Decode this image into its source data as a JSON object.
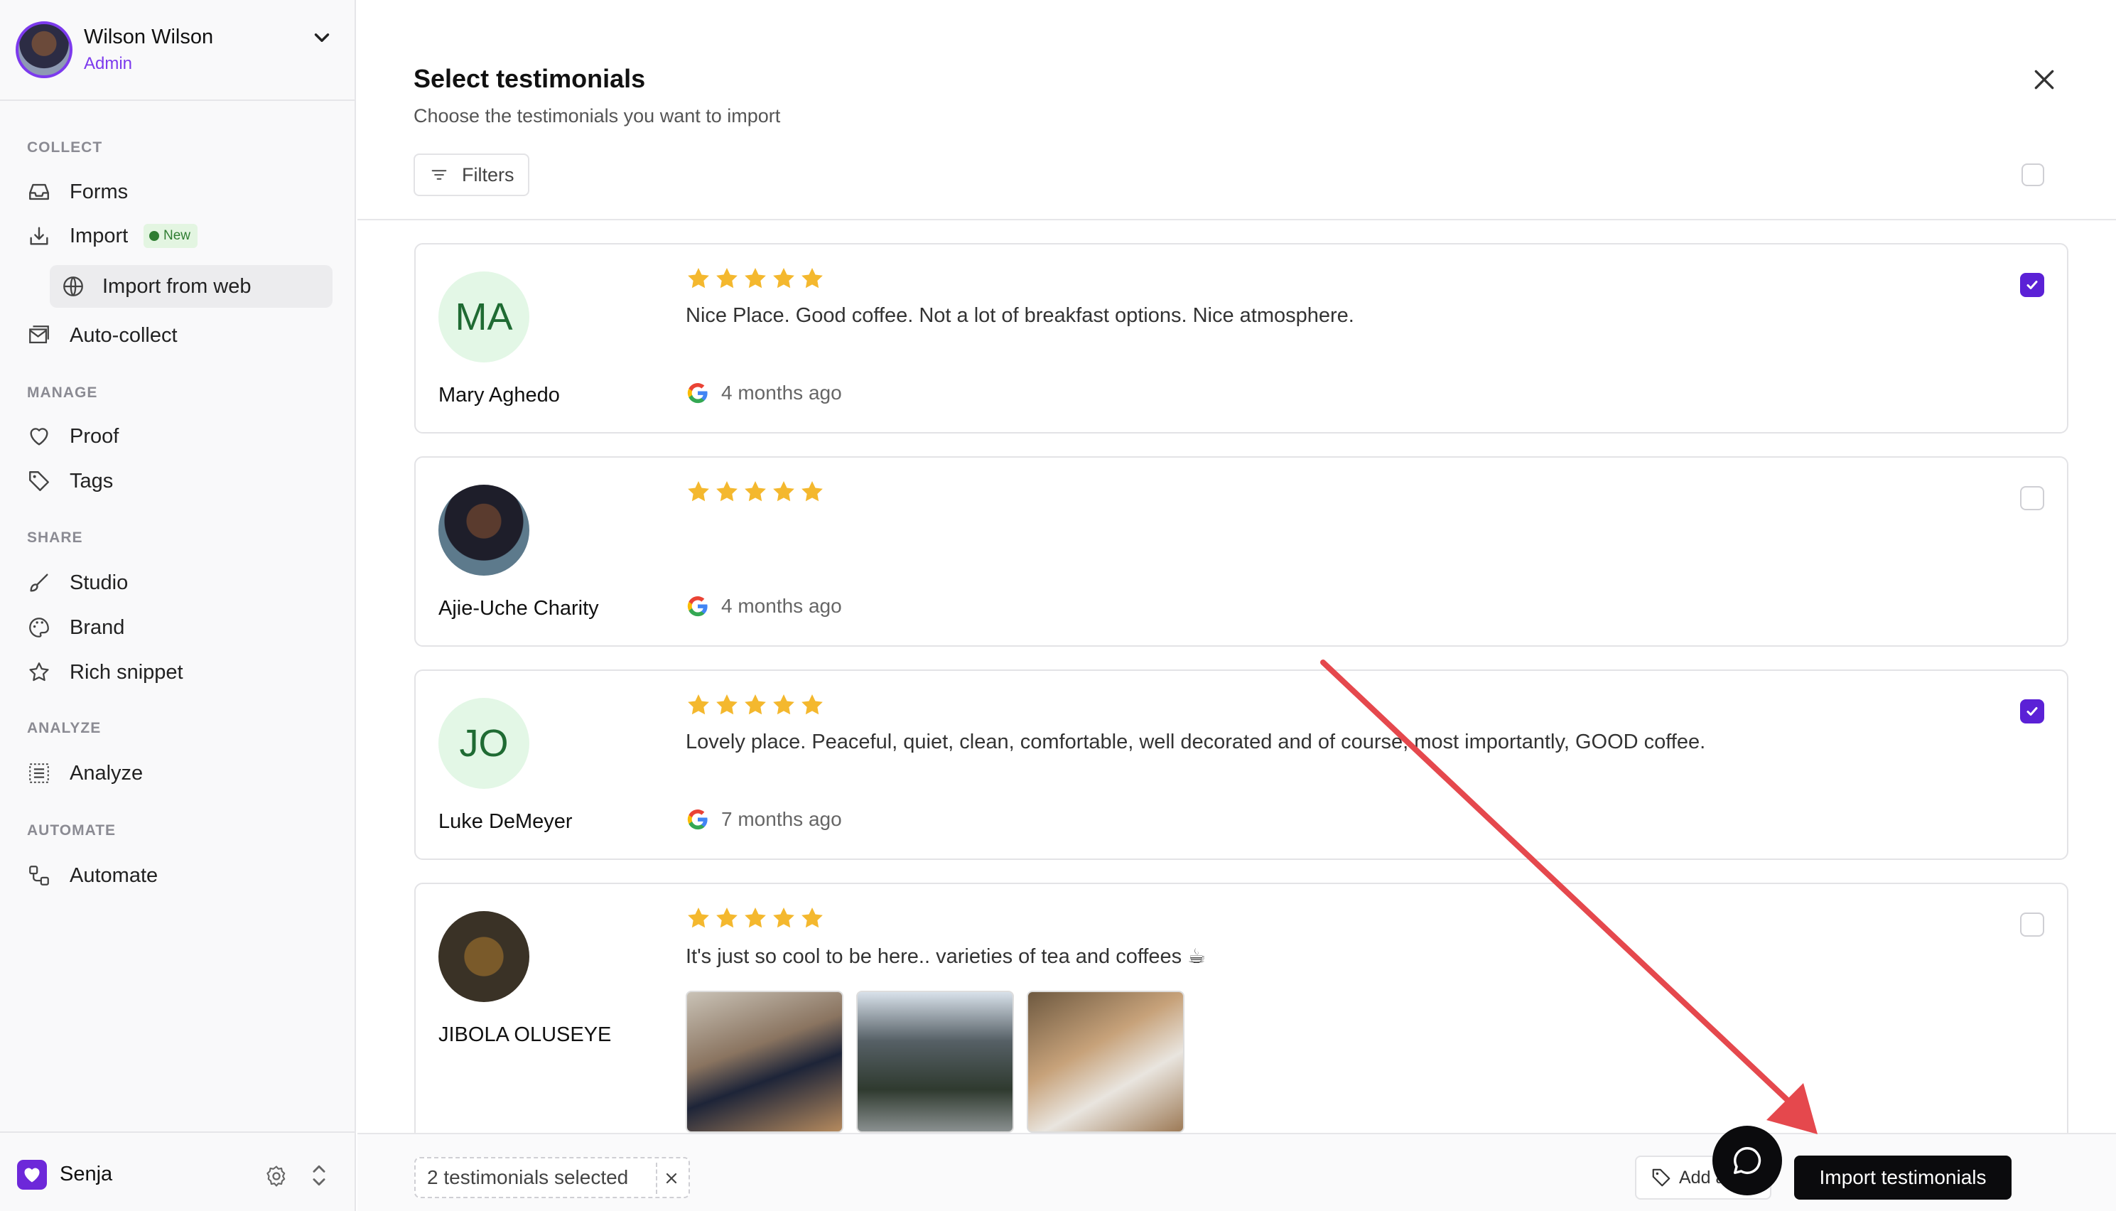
{
  "user": {
    "name": "Wilson Wilson",
    "role": "Admin"
  },
  "sidebar": {
    "sections": [
      {
        "label": "COLLECT"
      },
      {
        "label": "MANAGE"
      },
      {
        "label": "SHARE"
      },
      {
        "label": "ANALYZE"
      },
      {
        "label": "AUTOMATE"
      }
    ],
    "items": {
      "forms": "Forms",
      "import": "Import",
      "import_badge": "New",
      "import_from_web": "Import from web",
      "auto_collect": "Auto-collect",
      "proof": "Proof",
      "tags": "Tags",
      "studio": "Studio",
      "brand": "Brand",
      "rich_snippet": "Rich snippet",
      "analyze": "Analyze",
      "automate": "Automate"
    },
    "workspace": "Senja"
  },
  "dialog": {
    "title": "Select testimonials",
    "subtitle": "Choose the testimonials you want to import",
    "filters_label": "Filters"
  },
  "testimonials": [
    {
      "initials": "MA",
      "name": "Mary Aghedo",
      "rating": 5,
      "text": "Nice Place. Good coffee. Not a lot of breakfast options. Nice atmosphere.",
      "time": "4 months ago",
      "selected": true
    },
    {
      "initials": "",
      "name": "Ajie-Uche Charity",
      "rating": 5,
      "text": "",
      "time": "4 months ago",
      "selected": false
    },
    {
      "initials": "JO",
      "name": "Luke DeMeyer",
      "rating": 5,
      "text": "Lovely place. Peaceful, quiet, clean, comfortable, well decorated and of course, most importantly, GOOD coffee.",
      "time": "7 months ago",
      "selected": true
    },
    {
      "initials": "",
      "name": "JIBOLA OLUSEYE",
      "rating": 5,
      "text": "It's just so cool to be here.. varieties of tea and coffees ☕",
      "time": "",
      "selected": false
    }
  ],
  "footer": {
    "selected_label": "2 testimonials selected",
    "add_tag": "Add a tag",
    "import_button": "Import testimonials"
  },
  "colors": {
    "accent": "#5b21d6",
    "star": "#f4b82e",
    "annotation_arrow": "#e5484d"
  }
}
